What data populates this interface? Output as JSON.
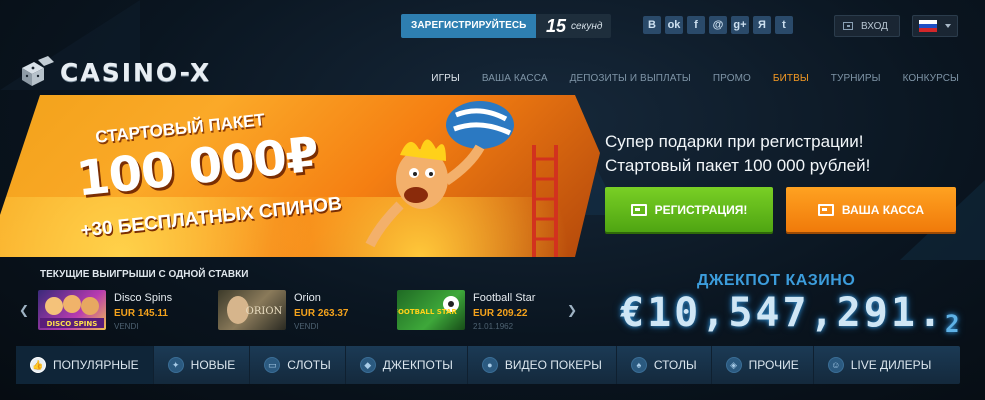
{
  "topbar": {
    "register_label": "ЗАРЕГИСТРИРУЙТЕСЬ ЗА",
    "register_seconds": "15",
    "register_seconds_unit": "секунд",
    "socials": [
      {
        "icon": "vk-icon",
        "glyph": "B"
      },
      {
        "icon": "odnoklassniki-icon",
        "glyph": "ok"
      },
      {
        "icon": "facebook-icon",
        "glyph": "f"
      },
      {
        "icon": "mailru-icon",
        "glyph": "@"
      },
      {
        "icon": "google-plus-icon",
        "glyph": "g+"
      },
      {
        "icon": "yandex-icon",
        "glyph": "Я"
      },
      {
        "icon": "twitter-icon",
        "glyph": "t"
      }
    ],
    "login_label": "ВХОД",
    "language_flag_colors": [
      "#ffffff",
      "#1f4fc4",
      "#d3272a"
    ]
  },
  "header": {
    "logo_text": "CASINO-X",
    "nav": [
      {
        "label": "ИГРЫ",
        "state": "active"
      },
      {
        "label": "ВАША КАССА",
        "state": "normal"
      },
      {
        "label": "ДЕПОЗИТЫ И ВЫПЛАТЫ",
        "state": "normal"
      },
      {
        "label": "ПРОМО",
        "state": "normal"
      },
      {
        "label": "БИТВЫ",
        "state": "orange"
      },
      {
        "label": "ТУРНИРЫ",
        "state": "normal"
      },
      {
        "label": "КОНКУРСЫ",
        "state": "normal"
      }
    ]
  },
  "banner": {
    "title": "СТАРТОВЫЙ ПАКЕТ",
    "amount": "100 000₽",
    "spins": "+30 БЕСПЛАТНЫХ СПИНОВ"
  },
  "promo": {
    "line1": "Супер подарки при регистрации!",
    "line2": "Стартовый пакет 100 000 рублей!",
    "register_button": "РЕГИСТРАЦИЯ!",
    "kassa_button": "ВАША КАССА"
  },
  "wins": {
    "title": "ТЕКУЩИЕ ВЫИГРЫШИ С ОДНОЙ СТАВКИ",
    "items": [
      {
        "game": "Disco Spins",
        "amount": "EUR 145.11",
        "user": "VENDI",
        "thumb_text": "DISCO SPINS"
      },
      {
        "game": "Orion",
        "amount": "EUR 263.37",
        "user": "VENDI",
        "thumb_text": "ORION"
      },
      {
        "game": "Football Star",
        "amount": "EUR 209.22",
        "user": "21.01.1962",
        "thumb_text": "FOOTBALL STAR"
      }
    ]
  },
  "jackpot": {
    "title": "ДЖЕКПОТ КАЗИНО",
    "value": "€10,547,291.",
    "value_sub": "2"
  },
  "categories": [
    {
      "label": "ПОПУЛЯРНЫЕ",
      "icon": "thumbs-up-icon",
      "glyph": "👍",
      "active": true
    },
    {
      "label": "НОВЫЕ",
      "icon": "new-badge-icon",
      "glyph": "✦",
      "active": false
    },
    {
      "label": "СЛОТЫ",
      "icon": "slots-icon",
      "glyph": "▭",
      "active": false
    },
    {
      "label": "ДЖЕКПОТЫ",
      "icon": "diamond-icon",
      "glyph": "◆",
      "active": false
    },
    {
      "label": "ВИДЕО ПОКЕРЫ",
      "icon": "poker-chip-icon",
      "glyph": "●",
      "active": false
    },
    {
      "label": "СТОЛЫ",
      "icon": "table-games-icon",
      "glyph": "♠",
      "active": false
    },
    {
      "label": "ПРОЧИЕ",
      "icon": "dice-icon",
      "glyph": "◈",
      "active": false
    },
    {
      "label": "LIVE ДИЛЕРЫ",
      "icon": "live-dealer-icon",
      "glyph": "☺",
      "active": false
    }
  ]
}
